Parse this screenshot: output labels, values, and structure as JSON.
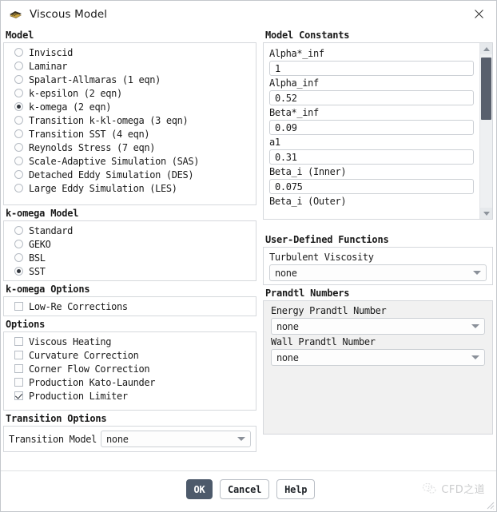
{
  "window": {
    "title": "Viscous Model",
    "icon": "mesh-icon",
    "close_label": "×"
  },
  "left": {
    "model_group": {
      "title": "Model",
      "options": [
        {
          "label": "Inviscid",
          "selected": false
        },
        {
          "label": "Laminar",
          "selected": false
        },
        {
          "label": "Spalart-Allmaras (1 eqn)",
          "selected": false
        },
        {
          "label": "k-epsilon (2 eqn)",
          "selected": false
        },
        {
          "label": "k-omega (2 eqn)",
          "selected": true
        },
        {
          "label": "Transition k-kl-omega (3 eqn)",
          "selected": false
        },
        {
          "label": "Transition SST (4 eqn)",
          "selected": false
        },
        {
          "label": "Reynolds Stress (7 eqn)",
          "selected": false
        },
        {
          "label": "Scale-Adaptive Simulation (SAS)",
          "selected": false
        },
        {
          "label": "Detached Eddy Simulation (DES)",
          "selected": false
        },
        {
          "label": "Large Eddy Simulation (LES)",
          "selected": false
        }
      ]
    },
    "komega_model_group": {
      "title": "k-omega Model",
      "options": [
        {
          "label": "Standard",
          "selected": false
        },
        {
          "label": "GEKO",
          "selected": false
        },
        {
          "label": "BSL",
          "selected": false
        },
        {
          "label": "SST",
          "selected": true
        }
      ]
    },
    "komega_options_group": {
      "title": "k-omega Options",
      "options": [
        {
          "label": "Low-Re Corrections",
          "checked": false
        }
      ]
    },
    "options_group": {
      "title": "Options",
      "options": [
        {
          "label": "Viscous Heating",
          "checked": false
        },
        {
          "label": "Curvature Correction",
          "checked": false
        },
        {
          "label": "Corner Flow Correction",
          "checked": false
        },
        {
          "label": "Production Kato-Launder",
          "checked": false
        },
        {
          "label": "Production Limiter",
          "checked": true
        }
      ]
    },
    "transition_options_group": {
      "title": "Transition Options",
      "field_label": "Transition Model",
      "field_value": "none"
    }
  },
  "right": {
    "constants_group": {
      "title": "Model Constants",
      "fields": [
        {
          "label": "Alpha*_inf",
          "value": "1"
        },
        {
          "label": "Alpha_inf",
          "value": "0.52"
        },
        {
          "label": "Beta*_inf",
          "value": "0.09"
        },
        {
          "label": "a1",
          "value": "0.31"
        },
        {
          "label": "Beta_i (Inner)",
          "value": "0.075"
        },
        {
          "label": "Beta_i (Outer)",
          "value": ""
        }
      ]
    },
    "udf_group": {
      "title": "User-Defined Functions",
      "field_label": "Turbulent Viscosity",
      "field_value": "none"
    },
    "prandtl_group": {
      "title": "Prandtl Numbers",
      "fields": [
        {
          "label": "Energy Prandtl Number",
          "value": "none"
        },
        {
          "label": "Wall Prandtl Number",
          "value": "none"
        }
      ]
    }
  },
  "footer": {
    "ok_label": "OK",
    "cancel_label": "Cancel",
    "help_label": "Help",
    "watermark_text": "CFD之道"
  },
  "colors": {
    "primary_button": "#4d5a6b",
    "panel_border": "#d5d8dc",
    "scroll_thumb": "#59606d"
  }
}
